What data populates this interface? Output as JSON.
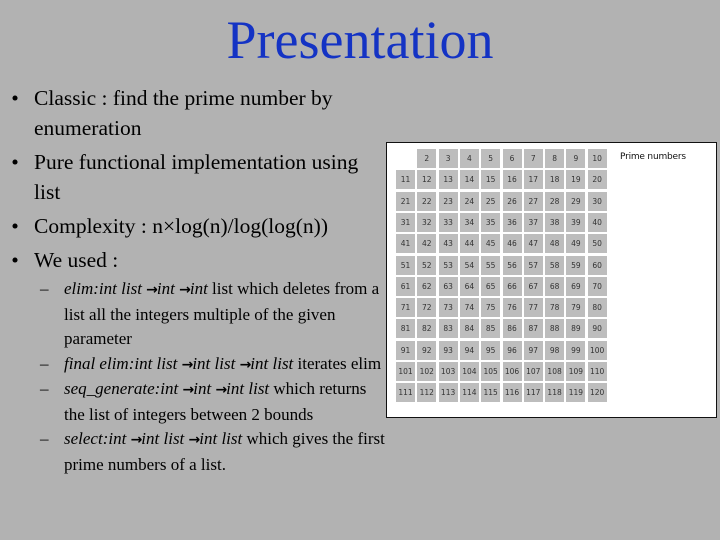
{
  "slide": {
    "title": "Presentation",
    "title_color": "#1433c4",
    "background_color": "#b2b2b2"
  },
  "bullets": [
    {
      "marker": "•",
      "text": "Classic : find the prime number by enumeration"
    },
    {
      "marker": "•",
      "text": "Pure functional implementation using list"
    },
    {
      "marker": "•",
      "text": "Complexity : n×log(n)/log(log(n))"
    },
    {
      "marker": "•",
      "text": "We used :"
    }
  ],
  "sub_bullets": [
    {
      "marker": "–",
      "signature_parts": [
        "elim:int list ",
        "int ",
        "int"
      ],
      "description": " list which deletes from a list all the integers multiple of the given parameter"
    },
    {
      "marker": "–",
      "signature_parts": [
        "final elim:int list ",
        "int list ",
        "int list"
      ],
      "description": " iterates elim"
    },
    {
      "marker": "–",
      "signature_parts": [
        "seq_generate:int ",
        "int ",
        "int list"
      ],
      "description": " which returns the list of integers between 2 bounds"
    },
    {
      "marker": "–",
      "signature_parts": [
        "select:int ",
        "int list ",
        "int list"
      ],
      "description": " which gives the first prime numbers of a list."
    }
  ],
  "arrow_glyph": "→",
  "figure": {
    "label": "Prime numbers",
    "range_start": 2,
    "range_end": 120,
    "columns": 10,
    "cell_color": "#bdbdbd"
  }
}
